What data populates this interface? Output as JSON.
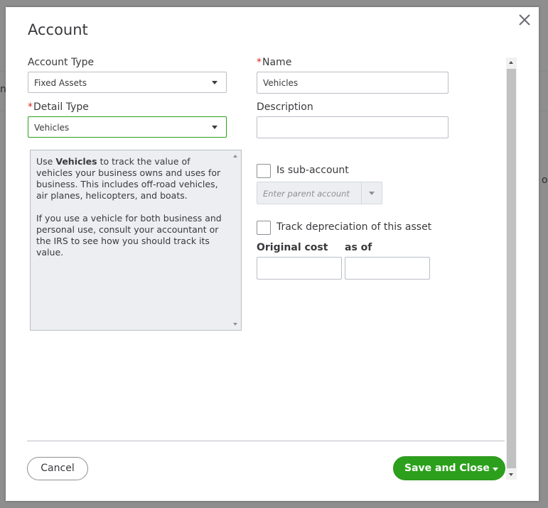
{
  "dialog": {
    "title": "Account",
    "account_type": {
      "label": "Account Type",
      "value": "Fixed Assets"
    },
    "detail_type": {
      "label": "Detail Type",
      "value": "Vehicles"
    },
    "name": {
      "label": "Name",
      "value": "Vehicles"
    },
    "description": {
      "label": "Description",
      "value": ""
    },
    "help": {
      "p1_prefix": "Use ",
      "p1_bold": "Vehicles",
      "p1_suffix": " to track the value of vehicles your business owns and uses for business. This includes off-road vehicles, air planes, helicopters, and boats.",
      "p2": "If you use a vehicle for both business and personal use, consult your accountant or the IRS to see how you should track its value."
    },
    "sub_account": {
      "label": "Is sub-account",
      "checked": false,
      "parent_placeholder": "Enter parent account"
    },
    "depreciation": {
      "label": "Track depreciation of this asset",
      "checked": false
    },
    "original_cost": {
      "label": "Original cost",
      "value": ""
    },
    "as_of": {
      "label": "as of",
      "value": ""
    },
    "required_marker": "*",
    "buttons": {
      "cancel": "Cancel",
      "save": "Save and Close"
    }
  },
  "background": {
    "fragment_left": "n",
    "fragment_right": "o"
  },
  "colors": {
    "accent": "#2ca01c",
    "required": "#d52b1e",
    "help_bg": "#eceef1"
  },
  "icons": [
    "close-icon",
    "caret-down-icon",
    "scroll-up-icon",
    "scroll-down-icon"
  ]
}
